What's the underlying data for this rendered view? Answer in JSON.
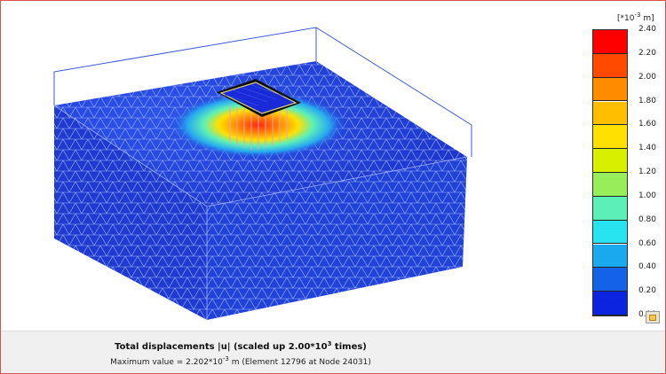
{
  "legend": {
    "unit_prefix": "[*10",
    "unit_exp": "-3",
    "unit_suffix": " m]",
    "ticks": [
      "2.40",
      "2.20",
      "2.00",
      "1.80",
      "1.60",
      "1.40",
      "1.20",
      "1.00",
      "0.80",
      "0.60",
      "0.40",
      "0.20",
      "0.00"
    ],
    "colors": [
      "#ff0000",
      "#ff4a00",
      "#ff8c00",
      "#ffbe00",
      "#ffe000",
      "#d8f000",
      "#98ee5a",
      "#5cf0b8",
      "#28e4f0",
      "#1aa8ee",
      "#1462e8",
      "#0c24e0"
    ]
  },
  "model_colors": {
    "soil_face": "#1f3fd4",
    "hotspot": "#ff4020",
    "mesh": "#9fb2ff",
    "box": "#3b5bd9"
  },
  "status": {
    "title_prefix": "Total displacements |u| (scaled up 2.00*10",
    "title_exp": "3",
    "title_suffix": " times)",
    "max_prefix": "Maximum value = 2.202*10",
    "max_exp": "-3",
    "max_suffix": " m (Element 12796 at Node 24031)"
  }
}
